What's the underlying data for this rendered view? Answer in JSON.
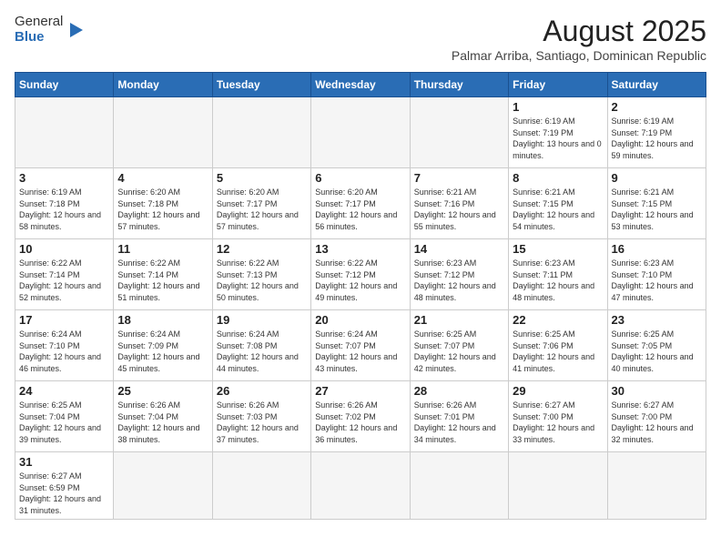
{
  "header": {
    "logo_general": "General",
    "logo_blue": "Blue",
    "month_year": "August 2025",
    "subtitle": "Palmar Arriba, Santiago, Dominican Republic"
  },
  "weekdays": [
    "Sunday",
    "Monday",
    "Tuesday",
    "Wednesday",
    "Thursday",
    "Friday",
    "Saturday"
  ],
  "weeks": [
    [
      {
        "day": "",
        "info": ""
      },
      {
        "day": "",
        "info": ""
      },
      {
        "day": "",
        "info": ""
      },
      {
        "day": "",
        "info": ""
      },
      {
        "day": "",
        "info": ""
      },
      {
        "day": "1",
        "info": "Sunrise: 6:19 AM\nSunset: 7:19 PM\nDaylight: 13 hours and 0 minutes."
      },
      {
        "day": "2",
        "info": "Sunrise: 6:19 AM\nSunset: 7:19 PM\nDaylight: 12 hours and 59 minutes."
      }
    ],
    [
      {
        "day": "3",
        "info": "Sunrise: 6:19 AM\nSunset: 7:18 PM\nDaylight: 12 hours and 58 minutes."
      },
      {
        "day": "4",
        "info": "Sunrise: 6:20 AM\nSunset: 7:18 PM\nDaylight: 12 hours and 57 minutes."
      },
      {
        "day": "5",
        "info": "Sunrise: 6:20 AM\nSunset: 7:17 PM\nDaylight: 12 hours and 57 minutes."
      },
      {
        "day": "6",
        "info": "Sunrise: 6:20 AM\nSunset: 7:17 PM\nDaylight: 12 hours and 56 minutes."
      },
      {
        "day": "7",
        "info": "Sunrise: 6:21 AM\nSunset: 7:16 PM\nDaylight: 12 hours and 55 minutes."
      },
      {
        "day": "8",
        "info": "Sunrise: 6:21 AM\nSunset: 7:15 PM\nDaylight: 12 hours and 54 minutes."
      },
      {
        "day": "9",
        "info": "Sunrise: 6:21 AM\nSunset: 7:15 PM\nDaylight: 12 hours and 53 minutes."
      }
    ],
    [
      {
        "day": "10",
        "info": "Sunrise: 6:22 AM\nSunset: 7:14 PM\nDaylight: 12 hours and 52 minutes."
      },
      {
        "day": "11",
        "info": "Sunrise: 6:22 AM\nSunset: 7:14 PM\nDaylight: 12 hours and 51 minutes."
      },
      {
        "day": "12",
        "info": "Sunrise: 6:22 AM\nSunset: 7:13 PM\nDaylight: 12 hours and 50 minutes."
      },
      {
        "day": "13",
        "info": "Sunrise: 6:22 AM\nSunset: 7:12 PM\nDaylight: 12 hours and 49 minutes."
      },
      {
        "day": "14",
        "info": "Sunrise: 6:23 AM\nSunset: 7:12 PM\nDaylight: 12 hours and 48 minutes."
      },
      {
        "day": "15",
        "info": "Sunrise: 6:23 AM\nSunset: 7:11 PM\nDaylight: 12 hours and 48 minutes."
      },
      {
        "day": "16",
        "info": "Sunrise: 6:23 AM\nSunset: 7:10 PM\nDaylight: 12 hours and 47 minutes."
      }
    ],
    [
      {
        "day": "17",
        "info": "Sunrise: 6:24 AM\nSunset: 7:10 PM\nDaylight: 12 hours and 46 minutes."
      },
      {
        "day": "18",
        "info": "Sunrise: 6:24 AM\nSunset: 7:09 PM\nDaylight: 12 hours and 45 minutes."
      },
      {
        "day": "19",
        "info": "Sunrise: 6:24 AM\nSunset: 7:08 PM\nDaylight: 12 hours and 44 minutes."
      },
      {
        "day": "20",
        "info": "Sunrise: 6:24 AM\nSunset: 7:07 PM\nDaylight: 12 hours and 43 minutes."
      },
      {
        "day": "21",
        "info": "Sunrise: 6:25 AM\nSunset: 7:07 PM\nDaylight: 12 hours and 42 minutes."
      },
      {
        "day": "22",
        "info": "Sunrise: 6:25 AM\nSunset: 7:06 PM\nDaylight: 12 hours and 41 minutes."
      },
      {
        "day": "23",
        "info": "Sunrise: 6:25 AM\nSunset: 7:05 PM\nDaylight: 12 hours and 40 minutes."
      }
    ],
    [
      {
        "day": "24",
        "info": "Sunrise: 6:25 AM\nSunset: 7:04 PM\nDaylight: 12 hours and 39 minutes."
      },
      {
        "day": "25",
        "info": "Sunrise: 6:26 AM\nSunset: 7:04 PM\nDaylight: 12 hours and 38 minutes."
      },
      {
        "day": "26",
        "info": "Sunrise: 6:26 AM\nSunset: 7:03 PM\nDaylight: 12 hours and 37 minutes."
      },
      {
        "day": "27",
        "info": "Sunrise: 6:26 AM\nSunset: 7:02 PM\nDaylight: 12 hours and 36 minutes."
      },
      {
        "day": "28",
        "info": "Sunrise: 6:26 AM\nSunset: 7:01 PM\nDaylight: 12 hours and 34 minutes."
      },
      {
        "day": "29",
        "info": "Sunrise: 6:27 AM\nSunset: 7:00 PM\nDaylight: 12 hours and 33 minutes."
      },
      {
        "day": "30",
        "info": "Sunrise: 6:27 AM\nSunset: 7:00 PM\nDaylight: 12 hours and 32 minutes."
      }
    ],
    [
      {
        "day": "31",
        "info": "Sunrise: 6:27 AM\nSunset: 6:59 PM\nDaylight: 12 hours and 31 minutes."
      },
      {
        "day": "",
        "info": ""
      },
      {
        "day": "",
        "info": ""
      },
      {
        "day": "",
        "info": ""
      },
      {
        "day": "",
        "info": ""
      },
      {
        "day": "",
        "info": ""
      },
      {
        "day": "",
        "info": ""
      }
    ]
  ]
}
